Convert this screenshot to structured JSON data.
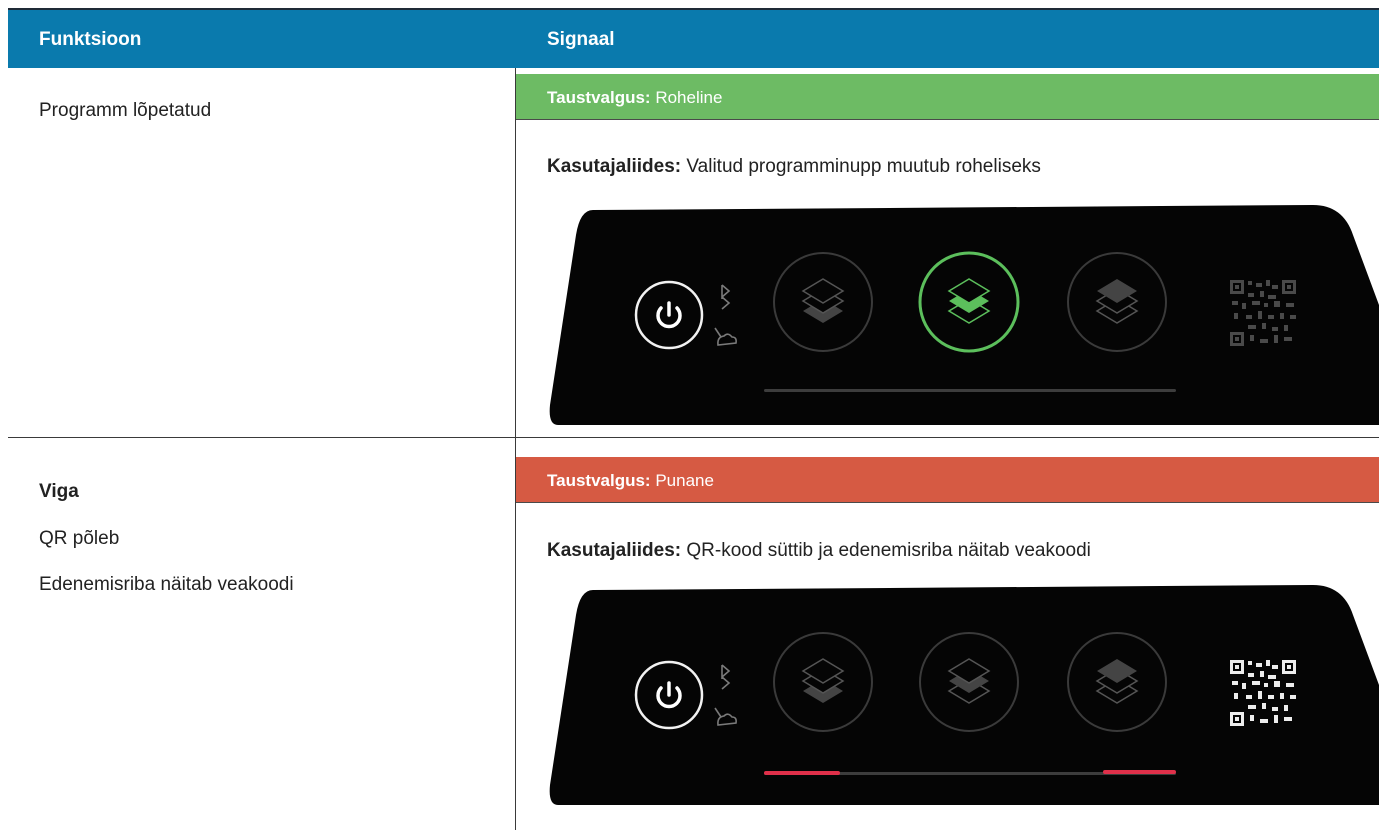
{
  "header": {
    "col_function": "Funktsioon",
    "col_signal": "Signaal"
  },
  "rows": [
    {
      "function_lines": [
        "Programm lõpetatud"
      ],
      "backlight_label": "Taustvalgus:",
      "backlight_value": "Roheline",
      "backlight_color": "#6dbb64",
      "ui_label": "Kasutajaliides:",
      "ui_value": "Valitud programminupp muutub roheliseks",
      "panel": {
        "selected_program": 2,
        "selected_ring_color": "#5cbf5c",
        "qr_lit": false,
        "error_bar": false
      }
    },
    {
      "function_title": "Viga",
      "function_lines": [
        "QR põleb",
        "Edenemisriba näitab veakoodi"
      ],
      "backlight_label": "Taustvalgus:",
      "backlight_value": "Punane",
      "backlight_color": "#d65a43",
      "ui_label": "Kasutajaliides:",
      "ui_value": "QR-kood süttib ja edenemisriba näitab veakoodi",
      "panel": {
        "selected_program": null,
        "qr_lit": true,
        "error_bar": true,
        "error_color": "#e0304a"
      }
    }
  ],
  "icons": [
    "power-icon",
    "bluetooth-icon",
    "cloud-icon",
    "layers-icon",
    "qr-code-icon"
  ]
}
